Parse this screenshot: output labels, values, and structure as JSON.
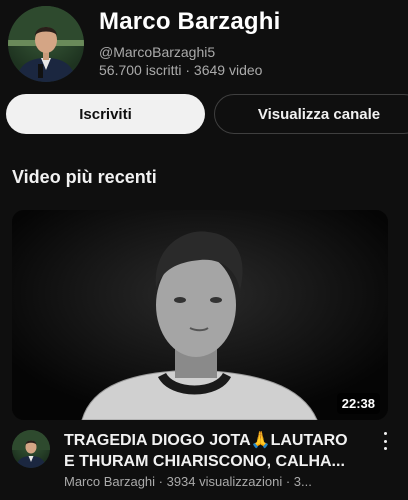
{
  "channel": {
    "name": "Marco Barzaghi",
    "handle": "@MarcoBarzaghi5",
    "stats": "56.700 iscritti · 3649 video",
    "avatar_icon": "presenter-portrait"
  },
  "actions": {
    "subscribe_label": "Iscriviti",
    "view_channel_label": "Visualizza canale"
  },
  "section": {
    "title": "Video più recenti"
  },
  "videos": [
    {
      "title_line1": "TRAGEDIA DIOGO JOTA🙏LAUTARO",
      "title_line2": "E THURAM CHIARISCONO, CALHA...",
      "meta": "Marco Barzaghi · 3934 visualizzazioni · 3...",
      "duration": "22:38",
      "thumbnail_icon": "football-player-portrait"
    }
  ],
  "colors": {
    "background": "#0f0f0f",
    "primary_text": "#f1f1f1",
    "secondary_text": "#aaaaaa",
    "subscribe_bg": "#f1f1f1"
  }
}
